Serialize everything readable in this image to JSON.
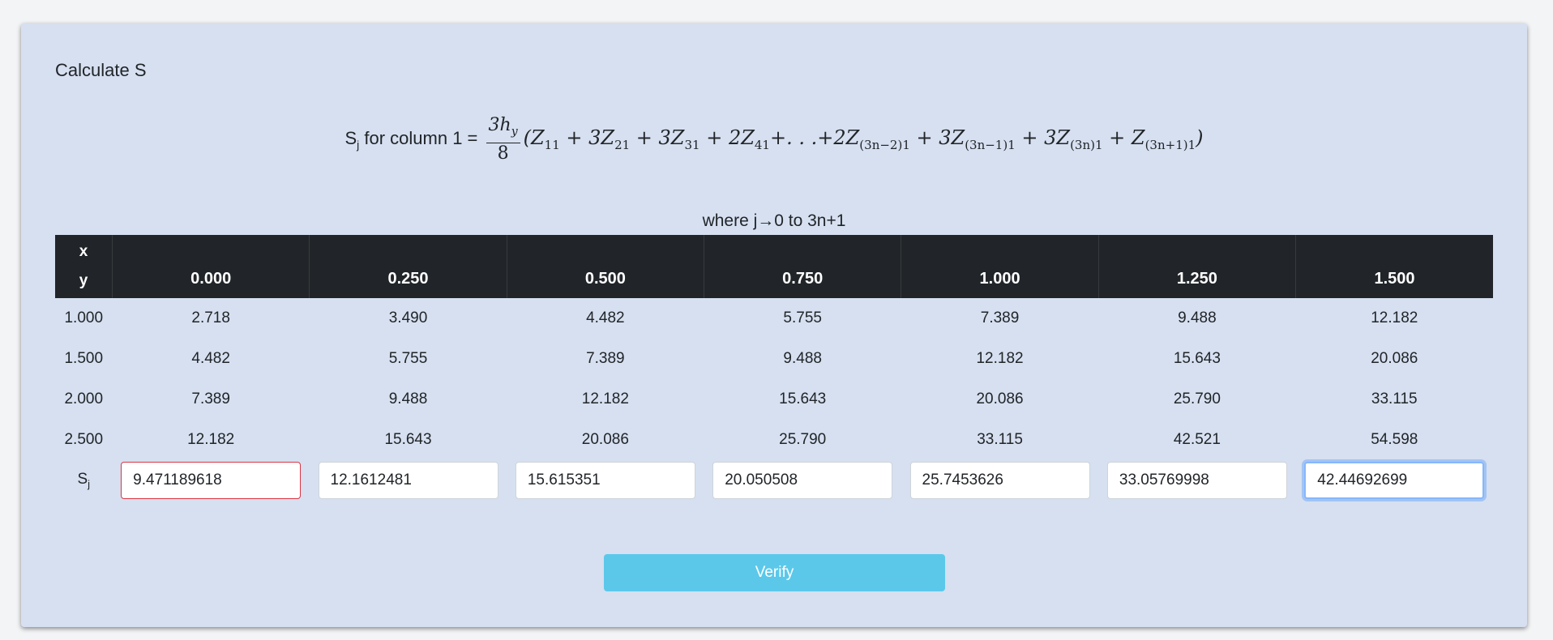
{
  "title": "Calculate S",
  "formula": {
    "lhs_main": "S",
    "lhs_sub": "j",
    "lhs_tail": " for column 1 = ",
    "frac_num": "3h",
    "frac_num_sub": "y",
    "frac_den": "8"
  },
  "where_text": "where j→0 to 3n+1",
  "table": {
    "corner_x": "x",
    "corner_y": "y",
    "headers": [
      "0.000",
      "0.250",
      "0.500",
      "0.750",
      "1.000",
      "1.250",
      "1.500"
    ],
    "rows": [
      {
        "y": "1.000",
        "values": [
          "2.718",
          "3.490",
          "4.482",
          "5.755",
          "7.389",
          "9.488",
          "12.182"
        ]
      },
      {
        "y": "1.500",
        "values": [
          "4.482",
          "5.755",
          "7.389",
          "9.488",
          "12.182",
          "15.643",
          "20.086"
        ]
      },
      {
        "y": "2.000",
        "values": [
          "7.389",
          "9.488",
          "12.182",
          "15.643",
          "20.086",
          "25.790",
          "33.115"
        ]
      },
      {
        "y": "2.500",
        "values": [
          "12.182",
          "15.643",
          "20.086",
          "25.790",
          "33.115",
          "42.521",
          "54.598"
        ]
      }
    ],
    "sj_label": "S",
    "sj_label_sub": "j",
    "sj_inputs": [
      "9.471189618",
      "12.1612481",
      "15.615351",
      "20.050508",
      "25.7453626",
      "33.05769998",
      "42.44692699"
    ]
  },
  "verify_label": "Verify",
  "colors": {
    "card_bg": "#d6e0f0",
    "header_bg": "#212529",
    "invalid_border": "#dc3545",
    "focus_border": "#86b7fe",
    "button_bg": "#5bc8ea"
  }
}
